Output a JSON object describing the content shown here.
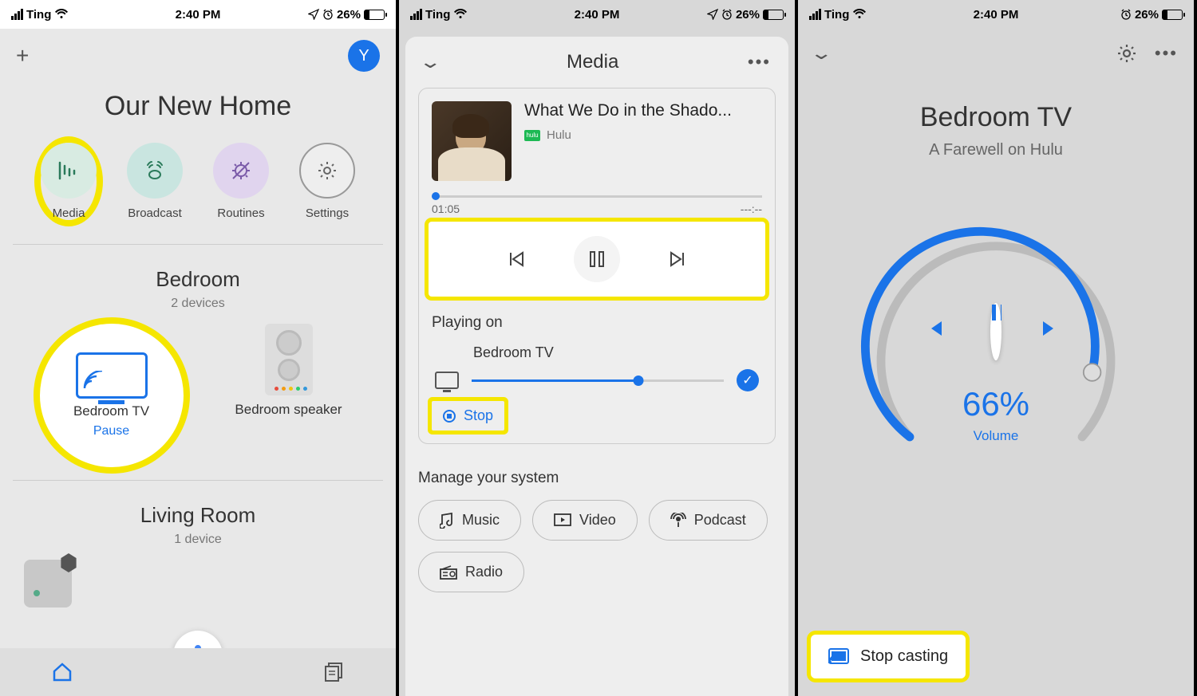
{
  "status": {
    "carrier": "Ting",
    "time": "2:40 PM",
    "battery_pct": "26%"
  },
  "screen1": {
    "avatar_letter": "Y",
    "home_title": "Our New Home",
    "quick": {
      "media": "Media",
      "broadcast": "Broadcast",
      "routines": "Routines",
      "settings": "Settings"
    },
    "room1": {
      "name": "Bedroom",
      "sub": "2 devices"
    },
    "dev_tv": {
      "name": "Bedroom TV",
      "action": "Pause"
    },
    "dev_spk": {
      "name": "Bedroom speaker"
    },
    "room2": {
      "name": "Living Room",
      "sub": "1 device"
    }
  },
  "screen2": {
    "header": "Media",
    "now_title": "What We Do in the Shado...",
    "provider": "Hulu",
    "elapsed": "01:05",
    "remaining": "---:--",
    "playing_on_label": "Playing on",
    "device": "Bedroom TV",
    "stop": "Stop",
    "manage_label": "Manage your system",
    "chips": {
      "music": "Music",
      "video": "Video",
      "podcast": "Podcast",
      "radio": "Radio"
    }
  },
  "screen3": {
    "title": "Bedroom TV",
    "subtitle": "A Farewell on Hulu",
    "volume_pct": "66%",
    "volume_label": "Volume",
    "stop_casting": "Stop casting"
  }
}
